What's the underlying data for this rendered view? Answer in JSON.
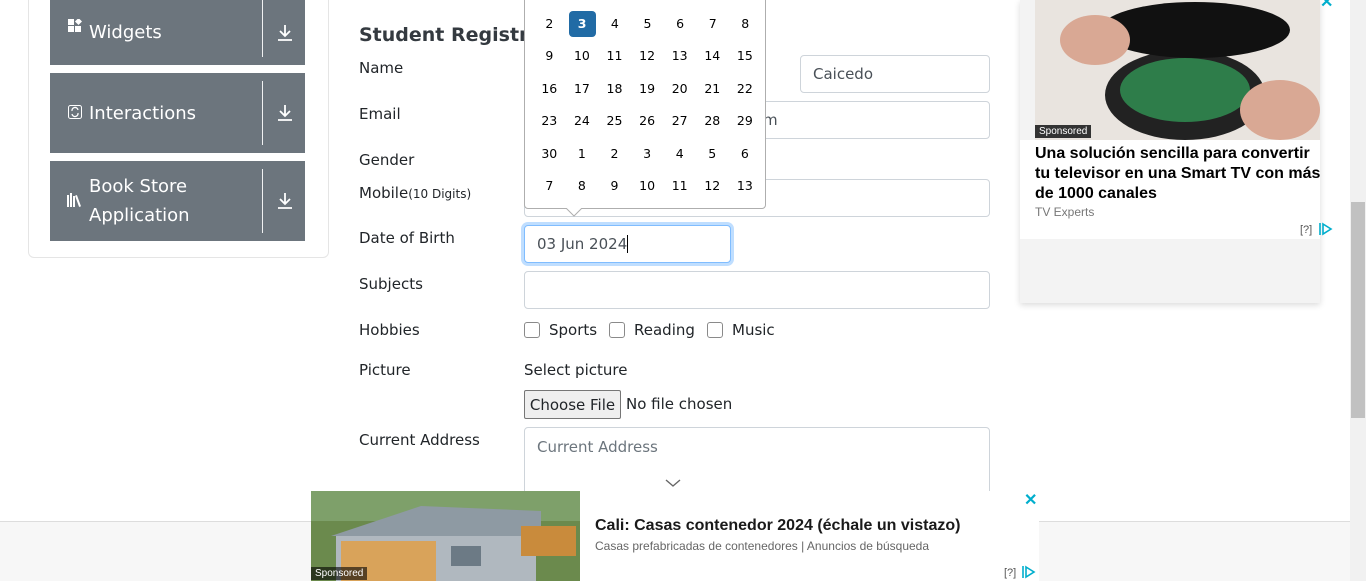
{
  "sidebar": {
    "groups": [
      {
        "label": "Widgets",
        "icon": "widgets-icon"
      },
      {
        "label": "Interactions",
        "icon": "interactions-icon"
      },
      {
        "label": "Book Store",
        "label2": "Application",
        "icon": "book-store-icon"
      }
    ]
  },
  "form": {
    "title": "Student Registratio",
    "labels": {
      "name": "Name",
      "email": "Email",
      "gender": "Gender",
      "mobile": "Mobile",
      "mobile_hint": "(10 Digits)",
      "dob": "Date of Birth",
      "subjects": "Subjects",
      "hobbies": "Hobbies",
      "picture": "Picture",
      "current_address": "Current Address"
    },
    "last_name_value": "Caicedo",
    "email_tail": "m",
    "dob_value": "03 Jun 2024",
    "hobbies": [
      "Sports",
      "Reading",
      "Music"
    ],
    "picture_prompt": "Select picture",
    "file_button": "Choose File",
    "file_status": "No file chosen",
    "address_placeholder": "Current Address"
  },
  "calendar": {
    "weeks": [
      [
        "2",
        "3",
        "4",
        "5",
        "6",
        "7",
        "8"
      ],
      [
        "9",
        "10",
        "11",
        "12",
        "13",
        "14",
        "15"
      ],
      [
        "16",
        "17",
        "18",
        "19",
        "20",
        "21",
        "22"
      ],
      [
        "23",
        "24",
        "25",
        "26",
        "27",
        "28",
        "29"
      ],
      [
        "30",
        "1",
        "2",
        "3",
        "4",
        "5",
        "6"
      ],
      [
        "7",
        "8",
        "9",
        "10",
        "11",
        "12",
        "13"
      ]
    ],
    "selected": "3"
  },
  "ads": {
    "right": {
      "sponsored": "Sponsored",
      "headline": "Una solución sencilla para convertir tu televisor en una Smart TV con más de 1000 canales",
      "source": "TV Experts",
      "info": "[?]"
    },
    "bottom": {
      "sponsored": "Sponsored",
      "headline": "Cali: Casas contenedor 2024 (échale un vistazo)",
      "source": "Casas prefabricadas de contenedores | Anuncios de búsqueda",
      "info": "[?]"
    }
  },
  "colors": {
    "sidebar_bg": "#6c757d",
    "calendar_selected": "#216ba5",
    "focus_border": "#80bdff",
    "ad_accent": "#00aecd"
  }
}
